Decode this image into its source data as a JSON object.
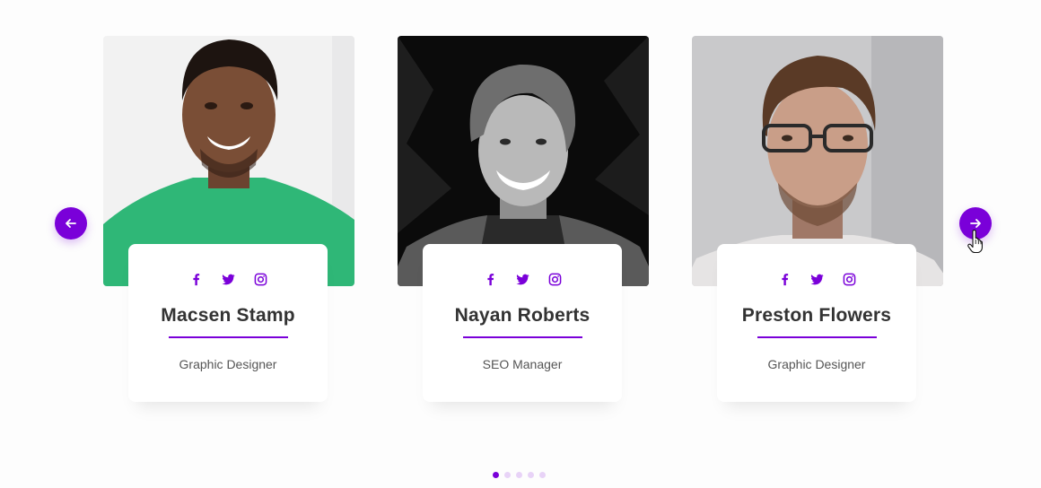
{
  "accent_color": "#7a00d9",
  "carousel": {
    "prev_icon": "arrow-left-icon",
    "next_icon": "arrow-right-icon",
    "page_count": 5,
    "active_page": 1
  },
  "members": [
    {
      "name": "Macsen Stamp",
      "role": "Graphic Designer",
      "socials": [
        "facebook-icon",
        "twitter-icon",
        "instagram-icon"
      ]
    },
    {
      "name": "Nayan Roberts",
      "role": "SEO Manager",
      "socials": [
        "facebook-icon",
        "twitter-icon",
        "instagram-icon"
      ]
    },
    {
      "name": "Preston Flowers",
      "role": "Graphic Designer",
      "socials": [
        "facebook-icon",
        "twitter-icon",
        "instagram-icon"
      ]
    }
  ]
}
